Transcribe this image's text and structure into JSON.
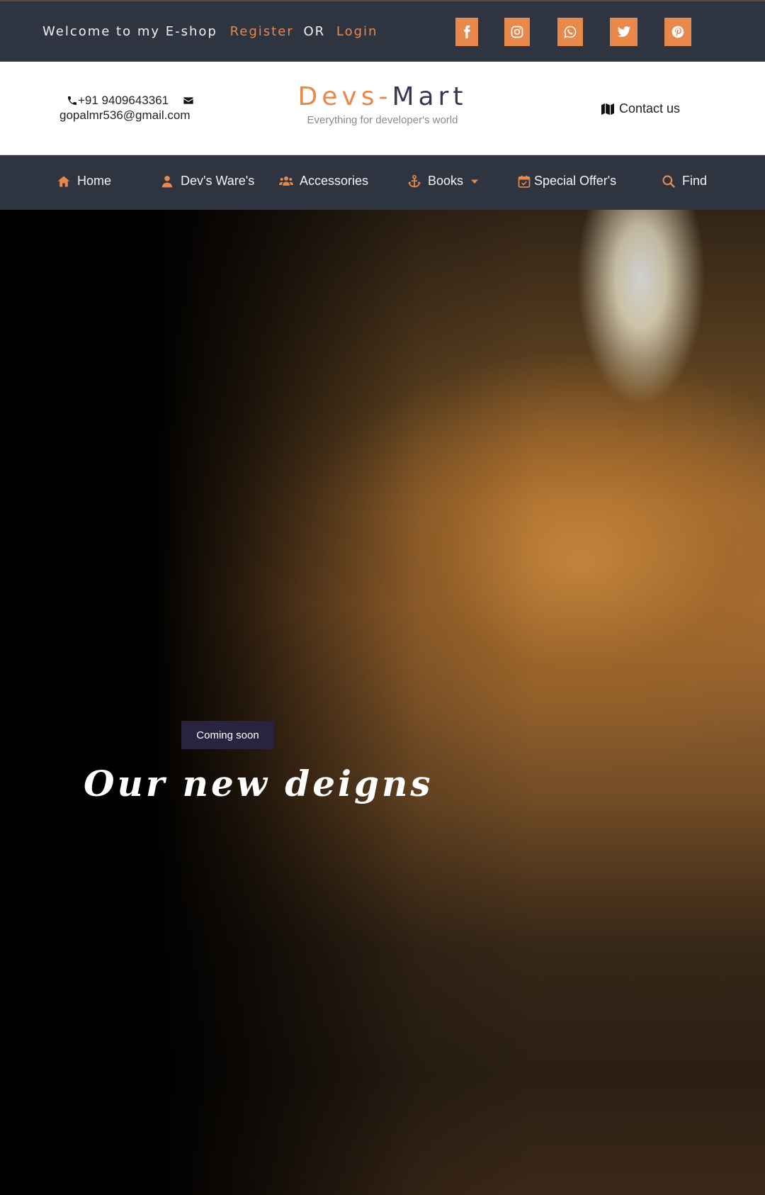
{
  "topbar": {
    "welcome_text": "Welcome to my E-shop",
    "register_label": "Register",
    "or_text": "OR",
    "login_label": "Login",
    "social_icons": [
      "facebook-icon",
      "instagram-icon",
      "whatsapp-icon",
      "twitter-icon",
      "pinterest-icon"
    ]
  },
  "header": {
    "phone": "+91 9409643361",
    "email": "gopalmr536@gmail.com",
    "brand_part1": "Devs-",
    "brand_part2": "Mart",
    "tagline": "Everything for developer's world",
    "contact_label": "Contact us"
  },
  "nav": {
    "items": [
      {
        "label": "Home",
        "icon": "home-icon"
      },
      {
        "label": "Dev's Ware's",
        "icon": "user-icon"
      },
      {
        "label": "Accessories",
        "icon": "users-icon"
      },
      {
        "label": "Books",
        "icon": "anchor-icon"
      },
      {
        "label": "Special Offer's",
        "icon": "calendar-check-icon"
      },
      {
        "label": "Find",
        "icon": "search-icon"
      }
    ]
  },
  "hero": {
    "badge": "Coming soon",
    "title": "Our new deigns"
  },
  "colors": {
    "accent": "#e8884a",
    "dark_bar": "#2f3540",
    "brand_dark": "#3b3553",
    "badge_bg": "#2a2340"
  }
}
